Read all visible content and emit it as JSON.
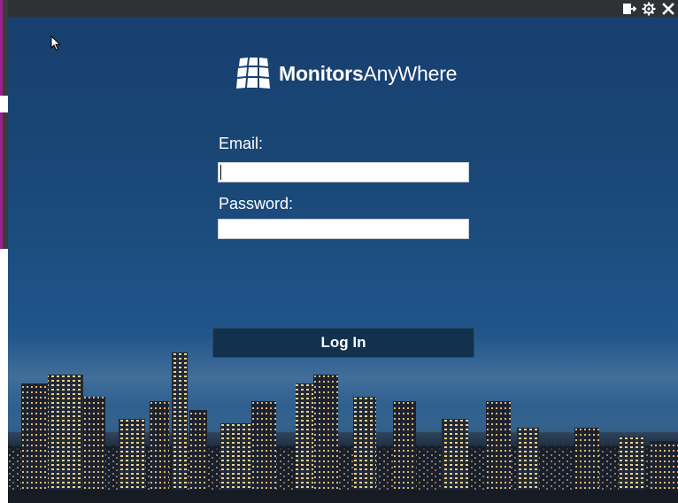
{
  "app": {
    "brand_bold": "Monitors",
    "brand_light": "AnyWhere",
    "logo_icon": "grid-logo-icon"
  },
  "title_bar": {
    "icons": [
      "logout-icon",
      "gear-icon",
      "close-icon"
    ]
  },
  "login_form": {
    "email_label": "Email:",
    "email_value": "",
    "password_label": "Password:",
    "password_value": "",
    "login_label": "Log In"
  },
  "colors": {
    "title_bar": "#2f3235",
    "background_top": "#173f6e",
    "button": "#12314f",
    "text": "#ffffff"
  }
}
